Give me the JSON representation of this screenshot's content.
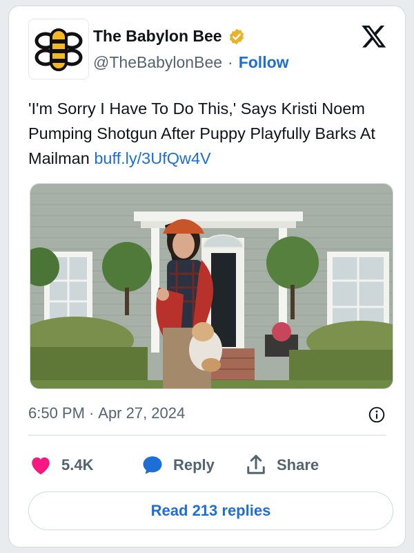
{
  "author": {
    "display_name": "The Babylon Bee",
    "handle": "@TheBabylonBee",
    "separator": "·",
    "follow_label": "Follow"
  },
  "icons": {
    "avatar": "babylon-bee-logo",
    "verified": "verified-badge-icon",
    "platform": "x-logo-icon",
    "info": "info-icon",
    "like": "heart-icon",
    "reply": "speech-bubble-icon",
    "share": "share-icon"
  },
  "tweet": {
    "text": "'I'm Sorry I Have To Do This,' Says Kristi Noem Pumping Shotgun After Puppy Playfully Barks At Mailman",
    "link": "buff.ly/3UfQw4V"
  },
  "meta": {
    "time": "6:50 PM",
    "separator": "·",
    "date": "Apr 27, 2024"
  },
  "actions": {
    "like_count": "5.4K",
    "reply_label": "Reply",
    "share_label": "Share"
  },
  "read_replies_label": "Read 213 replies",
  "colors": {
    "accent": "#1d6fd6",
    "like": "#f91880",
    "muted": "#536471",
    "verified": "#e8b22a"
  }
}
